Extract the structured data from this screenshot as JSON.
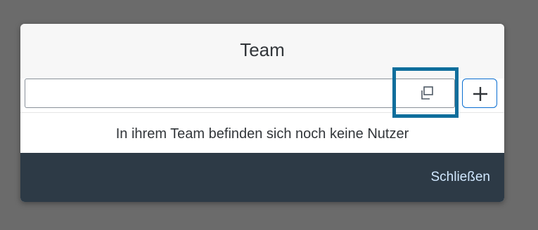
{
  "dialog": {
    "title": "Team",
    "search": {
      "value": "",
      "placeholder": ""
    },
    "value_help_icon": "value-help-icon",
    "add_icon": "add-icon",
    "empty_message": "In ihrem Team befinden sich noch keine Nutzer",
    "close_label": "Schließen"
  },
  "colors": {
    "highlight_border": "#0f6e9c",
    "footer_bg": "#2d3a46",
    "footer_text": "#d1e8ff",
    "accent": "#0a6ed1"
  }
}
